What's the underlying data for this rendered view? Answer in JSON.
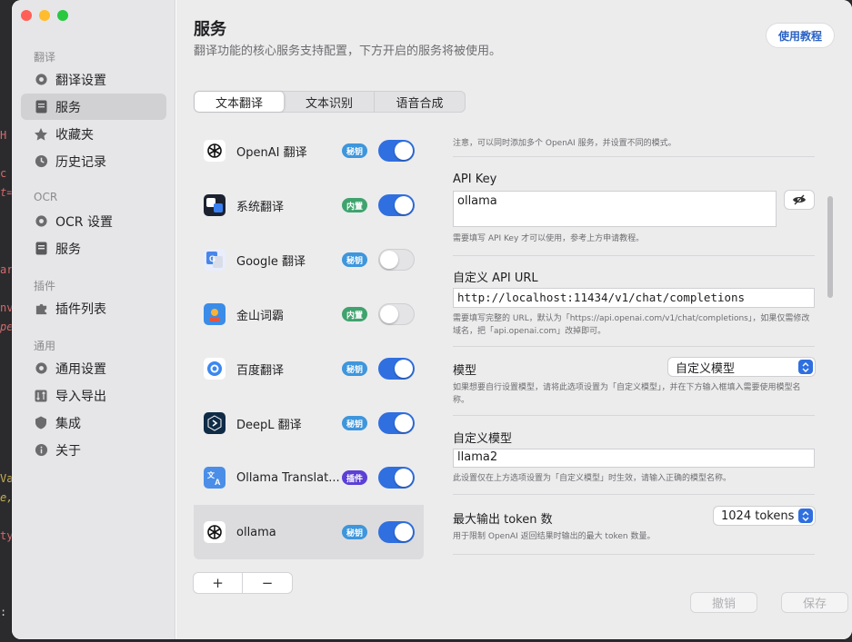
{
  "background_code_fragments": [
    "H",
    "c",
    "t=",
    "ar",
    "nv",
    "pe",
    "Va",
    "e,",
    "ty",
    ":"
  ],
  "sidebar": {
    "sections": [
      {
        "title": "翻译",
        "items": [
          {
            "label": "翻译设置",
            "icon": "gear-icon"
          },
          {
            "label": "服务",
            "icon": "document-icon"
          },
          {
            "label": "收藏夹",
            "icon": "star-icon"
          },
          {
            "label": "历史记录",
            "icon": "clock-icon"
          }
        ]
      },
      {
        "title": "OCR",
        "items": [
          {
            "label": "OCR 设置",
            "icon": "gear-icon"
          },
          {
            "label": "服务",
            "icon": "document-icon"
          }
        ]
      },
      {
        "title": "插件",
        "items": [
          {
            "label": "插件列表",
            "icon": "puzzle-icon"
          }
        ]
      },
      {
        "title": "通用",
        "items": [
          {
            "label": "通用设置",
            "icon": "gear-icon"
          },
          {
            "label": "导入导出",
            "icon": "import-export-icon"
          },
          {
            "label": "集成",
            "icon": "shield-icon"
          },
          {
            "label": "关于",
            "icon": "info-icon"
          }
        ]
      }
    ]
  },
  "header": {
    "title": "服务",
    "subtitle": "翻译功能的核心服务支持配置，下方开启的服务将被使用。",
    "tutorial_button": "使用教程"
  },
  "tabs": [
    "文本翻译",
    "文本识别",
    "语音合成"
  ],
  "services": [
    {
      "name": "OpenAI 翻译",
      "badge": "秘钥",
      "badge_color": "#3e96dc",
      "enabled": true,
      "icon": "openai-icon"
    },
    {
      "name": "系统翻译",
      "badge": "内置",
      "badge_color": "#3fa36e",
      "enabled": true,
      "icon": "system-translate-icon"
    },
    {
      "name": "Google 翻译",
      "badge": "秘钥",
      "badge_color": "#3e96dc",
      "enabled": false,
      "icon": "google-translate-icon"
    },
    {
      "name": "金山词霸",
      "badge": "内置",
      "badge_color": "#3fa36e",
      "enabled": false,
      "icon": "iciba-icon"
    },
    {
      "name": "百度翻译",
      "badge": "秘钥",
      "badge_color": "#3e96dc",
      "enabled": true,
      "icon": "baidu-translate-icon"
    },
    {
      "name": "DeepL 翻译",
      "badge": "秘钥",
      "badge_color": "#3e96dc",
      "enabled": true,
      "icon": "deepl-icon"
    },
    {
      "name": "Ollama Translat...",
      "badge": "插件",
      "badge_color": "#5b3fd6",
      "enabled": true,
      "icon": "translate-icon"
    },
    {
      "name": "ollama",
      "badge": "秘钥",
      "badge_color": "#3e96dc",
      "enabled": true,
      "icon": "openai-icon"
    }
  ],
  "list_controls": {
    "add": "+",
    "remove": "−"
  },
  "config": {
    "top_note": "注意，可以同时添加多个 OpenAI 服务，并设置不同的模式。",
    "api_key": {
      "label": "API Key",
      "value": "ollama",
      "desc": "需要填写 API Key 才可以使用，参考上方申请教程。"
    },
    "api_url": {
      "label": "自定义 API URL",
      "value": "http://localhost:11434/v1/chat/completions",
      "desc": "需要填写完整的 URL，默认为「https://api.openai.com/v1/chat/completions」，如果仅需修改域名，把「api.openai.com」改掉即可。"
    },
    "model": {
      "label": "模型",
      "value": "自定义模型",
      "desc": "如果想要自行设置模型，请将此选项设置为「自定义模型」，并在下方输入框填入需要使用模型名称。"
    },
    "custom_model": {
      "label": "自定义模型",
      "value": "llama2",
      "desc": "此设置仅在上方选项设置为「自定义模型」时生效，请输入正确的模型名称。"
    },
    "max_tokens": {
      "label": "最大输出 token 数",
      "value": "1024 tokens",
      "desc": "用于限制 OpenAI 返回结果时输出的最大 token 数量。"
    }
  },
  "footer": {
    "cancel": "撤销",
    "save": "保存"
  }
}
